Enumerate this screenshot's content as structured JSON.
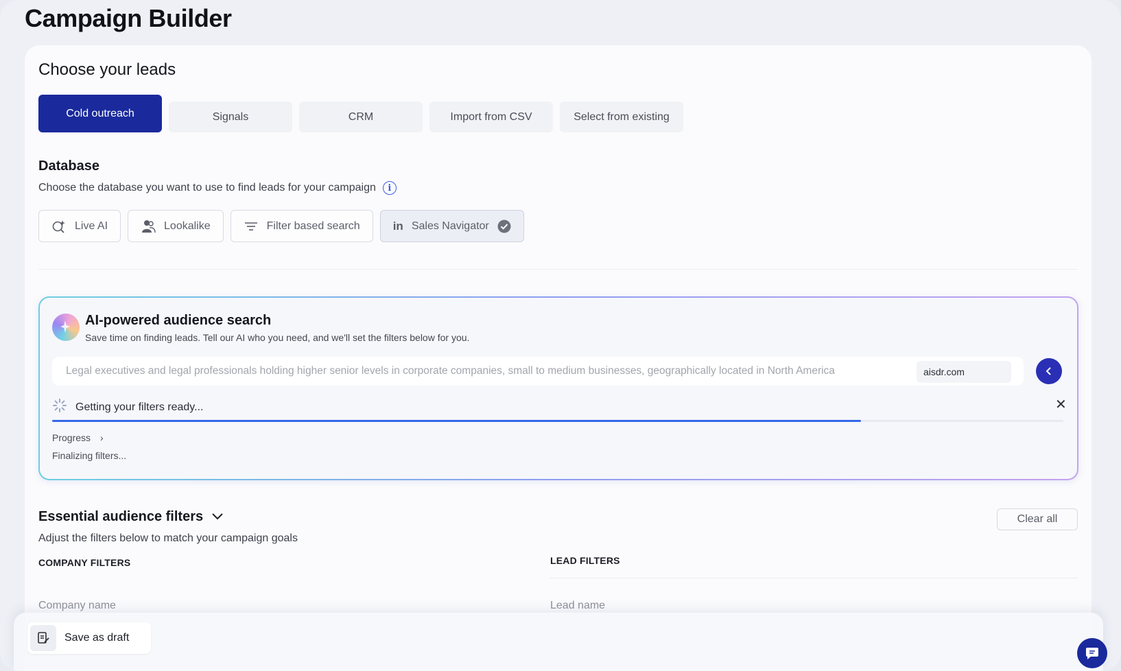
{
  "page": {
    "title": "Campaign Builder"
  },
  "leads": {
    "title": "Choose your leads",
    "tabs": [
      {
        "label": "Cold outreach",
        "active": true
      },
      {
        "label": "Signals",
        "active": false
      },
      {
        "label": "CRM",
        "active": false
      },
      {
        "label": "Import from CSV",
        "active": false
      },
      {
        "label": "Select from existing",
        "active": false
      }
    ]
  },
  "database": {
    "title": "Database",
    "description": "Choose the database you want to use to find leads for your campaign",
    "options": [
      {
        "label": "Live AI",
        "icon": "sparkle-search-icon",
        "selected": false
      },
      {
        "label": "Lookalike",
        "icon": "people-icon",
        "selected": false
      },
      {
        "label": "Filter based search",
        "icon": "filter-icon",
        "selected": false
      },
      {
        "label": "Sales Navigator",
        "icon": "linkedin-icon",
        "selected": true
      }
    ]
  },
  "ai_search": {
    "title": "AI-powered audience search",
    "subtitle": "Save time on finding leads. Tell our AI who you need, and we'll set the filters below for you.",
    "query": "Legal executives and legal professionals holding higher senior levels in corporate companies, small to medium businesses, geographically located in North America",
    "domain": "aisdr.com",
    "status": "Getting your filters ready...",
    "progress_percent": 80,
    "progress_label": "Progress",
    "progress_step": "Finalizing filters...",
    "colors": {
      "progress": "#3468e8",
      "send": "#2a2fb5"
    }
  },
  "filters": {
    "title": "Essential audience filters",
    "subtitle": "Adjust the filters below to match your campaign goals",
    "clear_label": "Clear all",
    "company": {
      "heading": "COMPANY FILTERS",
      "field_label": "Company name"
    },
    "lead": {
      "heading": "LEAD FILTERS",
      "field_label": "Lead name"
    }
  },
  "footer": {
    "save_draft_label": "Save as draft"
  },
  "brand": {
    "accent": "#1a2a9c"
  }
}
